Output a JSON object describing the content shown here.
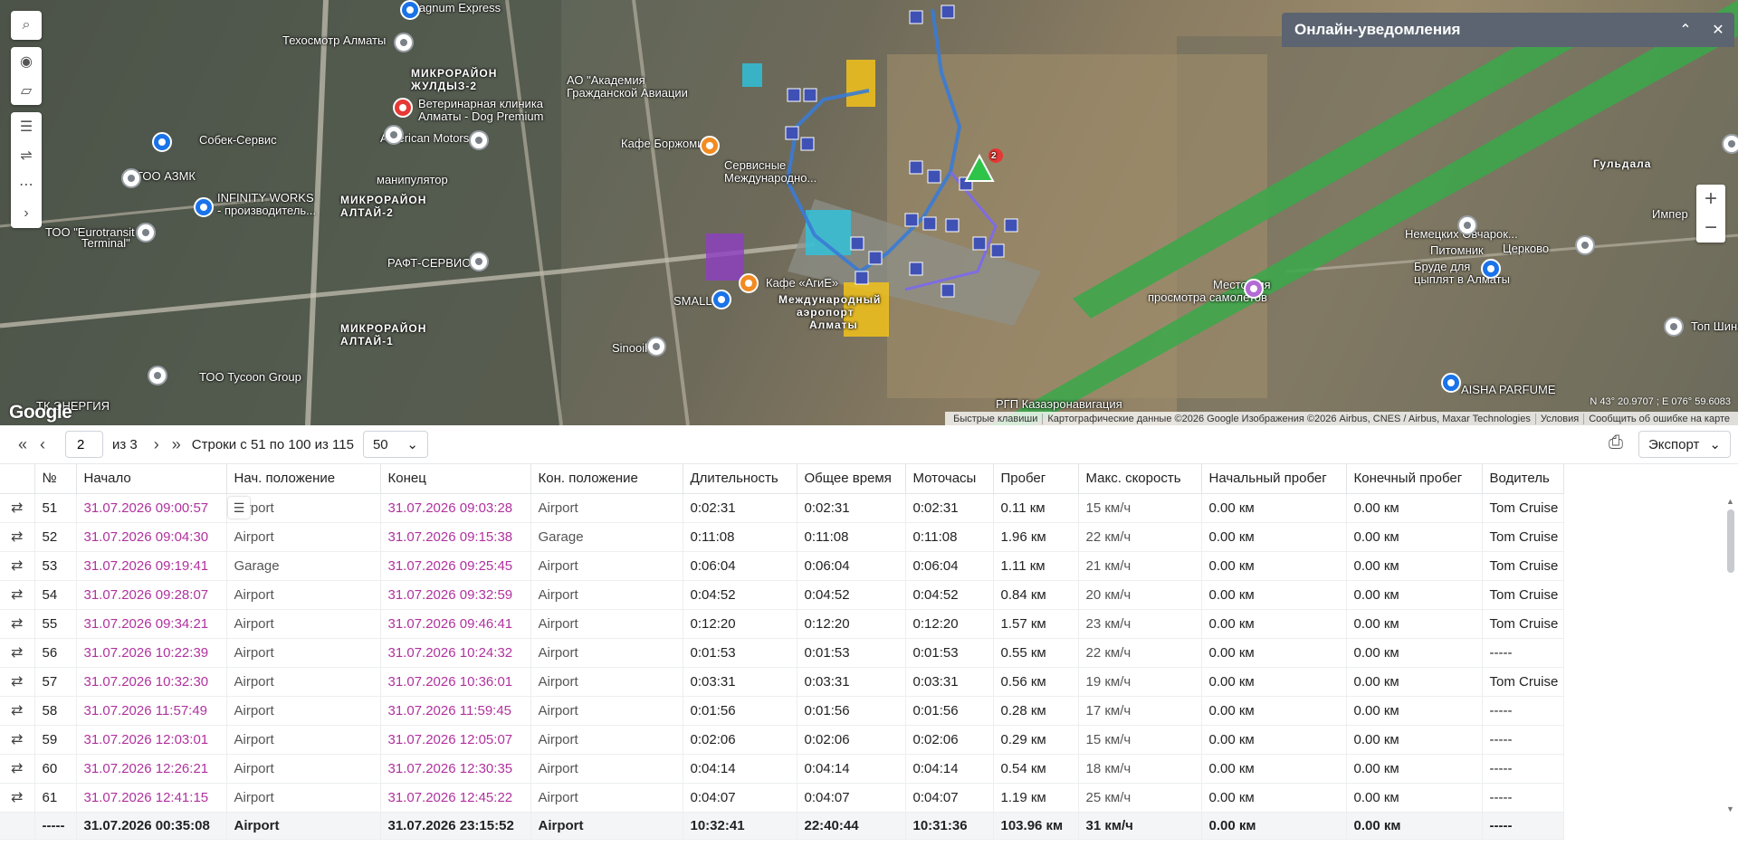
{
  "map": {
    "labels": [
      {
        "text": "Magnum Express",
        "cls": ""
      },
      {
        "text": "Техосмотр Алматы",
        "cls": ""
      },
      {
        "text": "МИКРОРАЙОН",
        "cls": "bold"
      },
      {
        "text": "ЖУЛДЫЗ-2",
        "cls": "bold"
      },
      {
        "text": "АО \"Академия",
        "cls": ""
      },
      {
        "text": "Гражданской Авиации",
        "cls": ""
      },
      {
        "text": "Ветеринарная клиника",
        "cls": ""
      },
      {
        "text": "Алматы - Dog Premium",
        "cls": ""
      },
      {
        "text": "American Motors",
        "cls": ""
      },
      {
        "text": "Кафе Боржоми",
        "cls": ""
      },
      {
        "text": "Собек-Сервис",
        "cls": ""
      },
      {
        "text": "ТОО АЗМК",
        "cls": ""
      },
      {
        "text": "манипулятор",
        "cls": ""
      },
      {
        "text": "МИКРОРАЙОН",
        "cls": "bold"
      },
      {
        "text": "АЛТАЙ-2",
        "cls": "bold"
      },
      {
        "text": "INFINITY WORKS",
        "cls": ""
      },
      {
        "text": "- производитель...",
        "cls": ""
      },
      {
        "text": "ТОО \"Eurotransit",
        "cls": ""
      },
      {
        "text": "Terminal\"",
        "cls": ""
      },
      {
        "text": "РАФТ-СЕРВИС",
        "cls": ""
      },
      {
        "text": "Сервисные",
        "cls": ""
      },
      {
        "text": "Международно...",
        "cls": ""
      },
      {
        "text": "Кафе «АгиЕ»",
        "cls": ""
      },
      {
        "text": "SMALL",
        "cls": ""
      },
      {
        "text": "Международный",
        "cls": "bold"
      },
      {
        "text": "аэропорт",
        "cls": "bold"
      },
      {
        "text": "Алматы",
        "cls": "bold"
      },
      {
        "text": "МИКРОРАЙОН",
        "cls": "bold"
      },
      {
        "text": "АЛТАЙ-1",
        "cls": "bold"
      },
      {
        "text": "Sinooil",
        "cls": ""
      },
      {
        "text": "ТОО Tycoon Group",
        "cls": ""
      },
      {
        "text": "ТК ЭНЕРГИЯ",
        "cls": ""
      },
      {
        "text": "Место для",
        "cls": ""
      },
      {
        "text": "просмотра самолетов",
        "cls": ""
      },
      {
        "text": "Питомник",
        "cls": ""
      },
      {
        "text": "Немецких Овчарок...",
        "cls": ""
      },
      {
        "text": "Бруде для",
        "cls": ""
      },
      {
        "text": "цыплят в Алматы",
        "cls": ""
      },
      {
        "text": "Гульдала",
        "cls": "bold"
      },
      {
        "text": "Церково",
        "cls": ""
      },
      {
        "text": "Импер",
        "cls": ""
      },
      {
        "text": "Топ Шина",
        "cls": ""
      },
      {
        "text": "AISHA PARFUME",
        "cls": ""
      },
      {
        "text": "РГП Казаэронавигация",
        "cls": ""
      }
    ],
    "pois": [
      {
        "cls": "blue"
      },
      {
        "cls": ""
      },
      {
        "cls": ""
      },
      {
        "cls": "red"
      },
      {
        "cls": ""
      },
      {
        "cls": "orange"
      },
      {
        "cls": "blue"
      },
      {
        "cls": ""
      },
      {
        "cls": "blue"
      },
      {
        "cls": ""
      },
      {
        "cls": ""
      },
      {
        "cls": "orange"
      },
      {
        "cls": "blue"
      },
      {
        "cls": ""
      },
      {
        "cls": ""
      },
      {
        "cls": "purple"
      },
      {
        "cls": ""
      },
      {
        "cls": "blue"
      },
      {
        "cls": ""
      },
      {
        "cls": ""
      },
      {
        "cls": "blue"
      },
      {
        "cls": ""
      }
    ],
    "marker_badge": "2",
    "google": "Google",
    "coords": "N 43° 20.9707 ; E 076° 59.6083",
    "attribution": [
      "Быстрые клавиши",
      "Картографические данные ©2026 Google Изображения ©2026 Airbus, CNES / Airbus, Maxar Technologies",
      "Условия",
      "Сообщить об ошибке на карте"
    ],
    "tools": [
      "search-icon",
      "eye-icon",
      "map-icon",
      "ruler-icon",
      "route-icon",
      "track-icon",
      "chevron-right-icon"
    ],
    "zoom_in": "+",
    "zoom_out": "−"
  },
  "notifications": {
    "title": "Онлайн-уведомления"
  },
  "pager": {
    "page": "2",
    "of": "из 3",
    "rows_info": "Строки с 51 по 100 из 115",
    "page_size": "50",
    "export": "Экспорт"
  },
  "table": {
    "columns": [
      "",
      "№",
      "Начало",
      "Нач. положение",
      "Конец",
      "Кон. положение",
      "Длительность",
      "Общее время",
      "Моточасы",
      "Пробег",
      "Макс. скорость",
      "Начальный пробег",
      "Конечный пробег",
      "Водитель"
    ],
    "rows": [
      [
        "51",
        "31.07.2026 09:00:57",
        "Airport",
        "31.07.2026 09:03:28",
        "Airport",
        "0:02:31",
        "0:02:31",
        "0:02:31",
        "0.11 км",
        "15 км/ч",
        "0.00 км",
        "0.00 км",
        "Tom Cruise"
      ],
      [
        "52",
        "31.07.2026 09:04:30",
        "Airport",
        "31.07.2026 09:15:38",
        "Garage",
        "0:11:08",
        "0:11:08",
        "0:11:08",
        "1.96 км",
        "22 км/ч",
        "0.00 км",
        "0.00 км",
        "Tom Cruise"
      ],
      [
        "53",
        "31.07.2026 09:19:41",
        "Garage",
        "31.07.2026 09:25:45",
        "Airport",
        "0:06:04",
        "0:06:04",
        "0:06:04",
        "1.11 км",
        "21 км/ч",
        "0.00 км",
        "0.00 км",
        "Tom Cruise"
      ],
      [
        "54",
        "31.07.2026 09:28:07",
        "Airport",
        "31.07.2026 09:32:59",
        "Airport",
        "0:04:52",
        "0:04:52",
        "0:04:52",
        "0.84 км",
        "20 км/ч",
        "0.00 км",
        "0.00 км",
        "Tom Cruise"
      ],
      [
        "55",
        "31.07.2026 09:34:21",
        "Airport",
        "31.07.2026 09:46:41",
        "Airport",
        "0:12:20",
        "0:12:20",
        "0:12:20",
        "1.57 км",
        "23 км/ч",
        "0.00 км",
        "0.00 км",
        "Tom Cruise"
      ],
      [
        "56",
        "31.07.2026 10:22:39",
        "Airport",
        "31.07.2026 10:24:32",
        "Airport",
        "0:01:53",
        "0:01:53",
        "0:01:53",
        "0.55 км",
        "22 км/ч",
        "0.00 км",
        "0.00 км",
        "-----"
      ],
      [
        "57",
        "31.07.2026 10:32:30",
        "Airport",
        "31.07.2026 10:36:01",
        "Airport",
        "0:03:31",
        "0:03:31",
        "0:03:31",
        "0.56 км",
        "19 км/ч",
        "0.00 км",
        "0.00 км",
        "Tom Cruise"
      ],
      [
        "58",
        "31.07.2026 11:57:49",
        "Airport",
        "31.07.2026 11:59:45",
        "Airport",
        "0:01:56",
        "0:01:56",
        "0:01:56",
        "0.28 км",
        "17 км/ч",
        "0.00 км",
        "0.00 км",
        "-----"
      ],
      [
        "59",
        "31.07.2026 12:03:01",
        "Airport",
        "31.07.2026 12:05:07",
        "Airport",
        "0:02:06",
        "0:02:06",
        "0:02:06",
        "0.29 км",
        "15 км/ч",
        "0.00 км",
        "0.00 км",
        "-----"
      ],
      [
        "60",
        "31.07.2026 12:26:21",
        "Airport",
        "31.07.2026 12:30:35",
        "Airport",
        "0:04:14",
        "0:04:14",
        "0:04:14",
        "0.54 км",
        "18 км/ч",
        "0.00 км",
        "0.00 км",
        "-----"
      ],
      [
        "61",
        "31.07.2026 12:41:15",
        "Airport",
        "31.07.2026 12:45:22",
        "Airport",
        "0:04:07",
        "0:04:07",
        "0:04:07",
        "1.19 км",
        "25 км/ч",
        "0.00 км",
        "0.00 км",
        "-----"
      ]
    ],
    "total": [
      "-----",
      "31.07.2026 00:35:08",
      "Airport",
      "31.07.2026 23:15:52",
      "Airport",
      "10:32:41",
      "22:40:44",
      "10:31:36",
      "103.96 км",
      "31 км/ч",
      "0.00 км",
      "0.00 км",
      "-----"
    ]
  },
  "colors": {
    "link": "#b0329e",
    "route": "#3a7bd5",
    "zone_yellow": "#f2c21b",
    "zone_cyan": "#2ec4e0",
    "zone_purple": "#8e3fc4",
    "runway_green": "#3aa84a"
  }
}
